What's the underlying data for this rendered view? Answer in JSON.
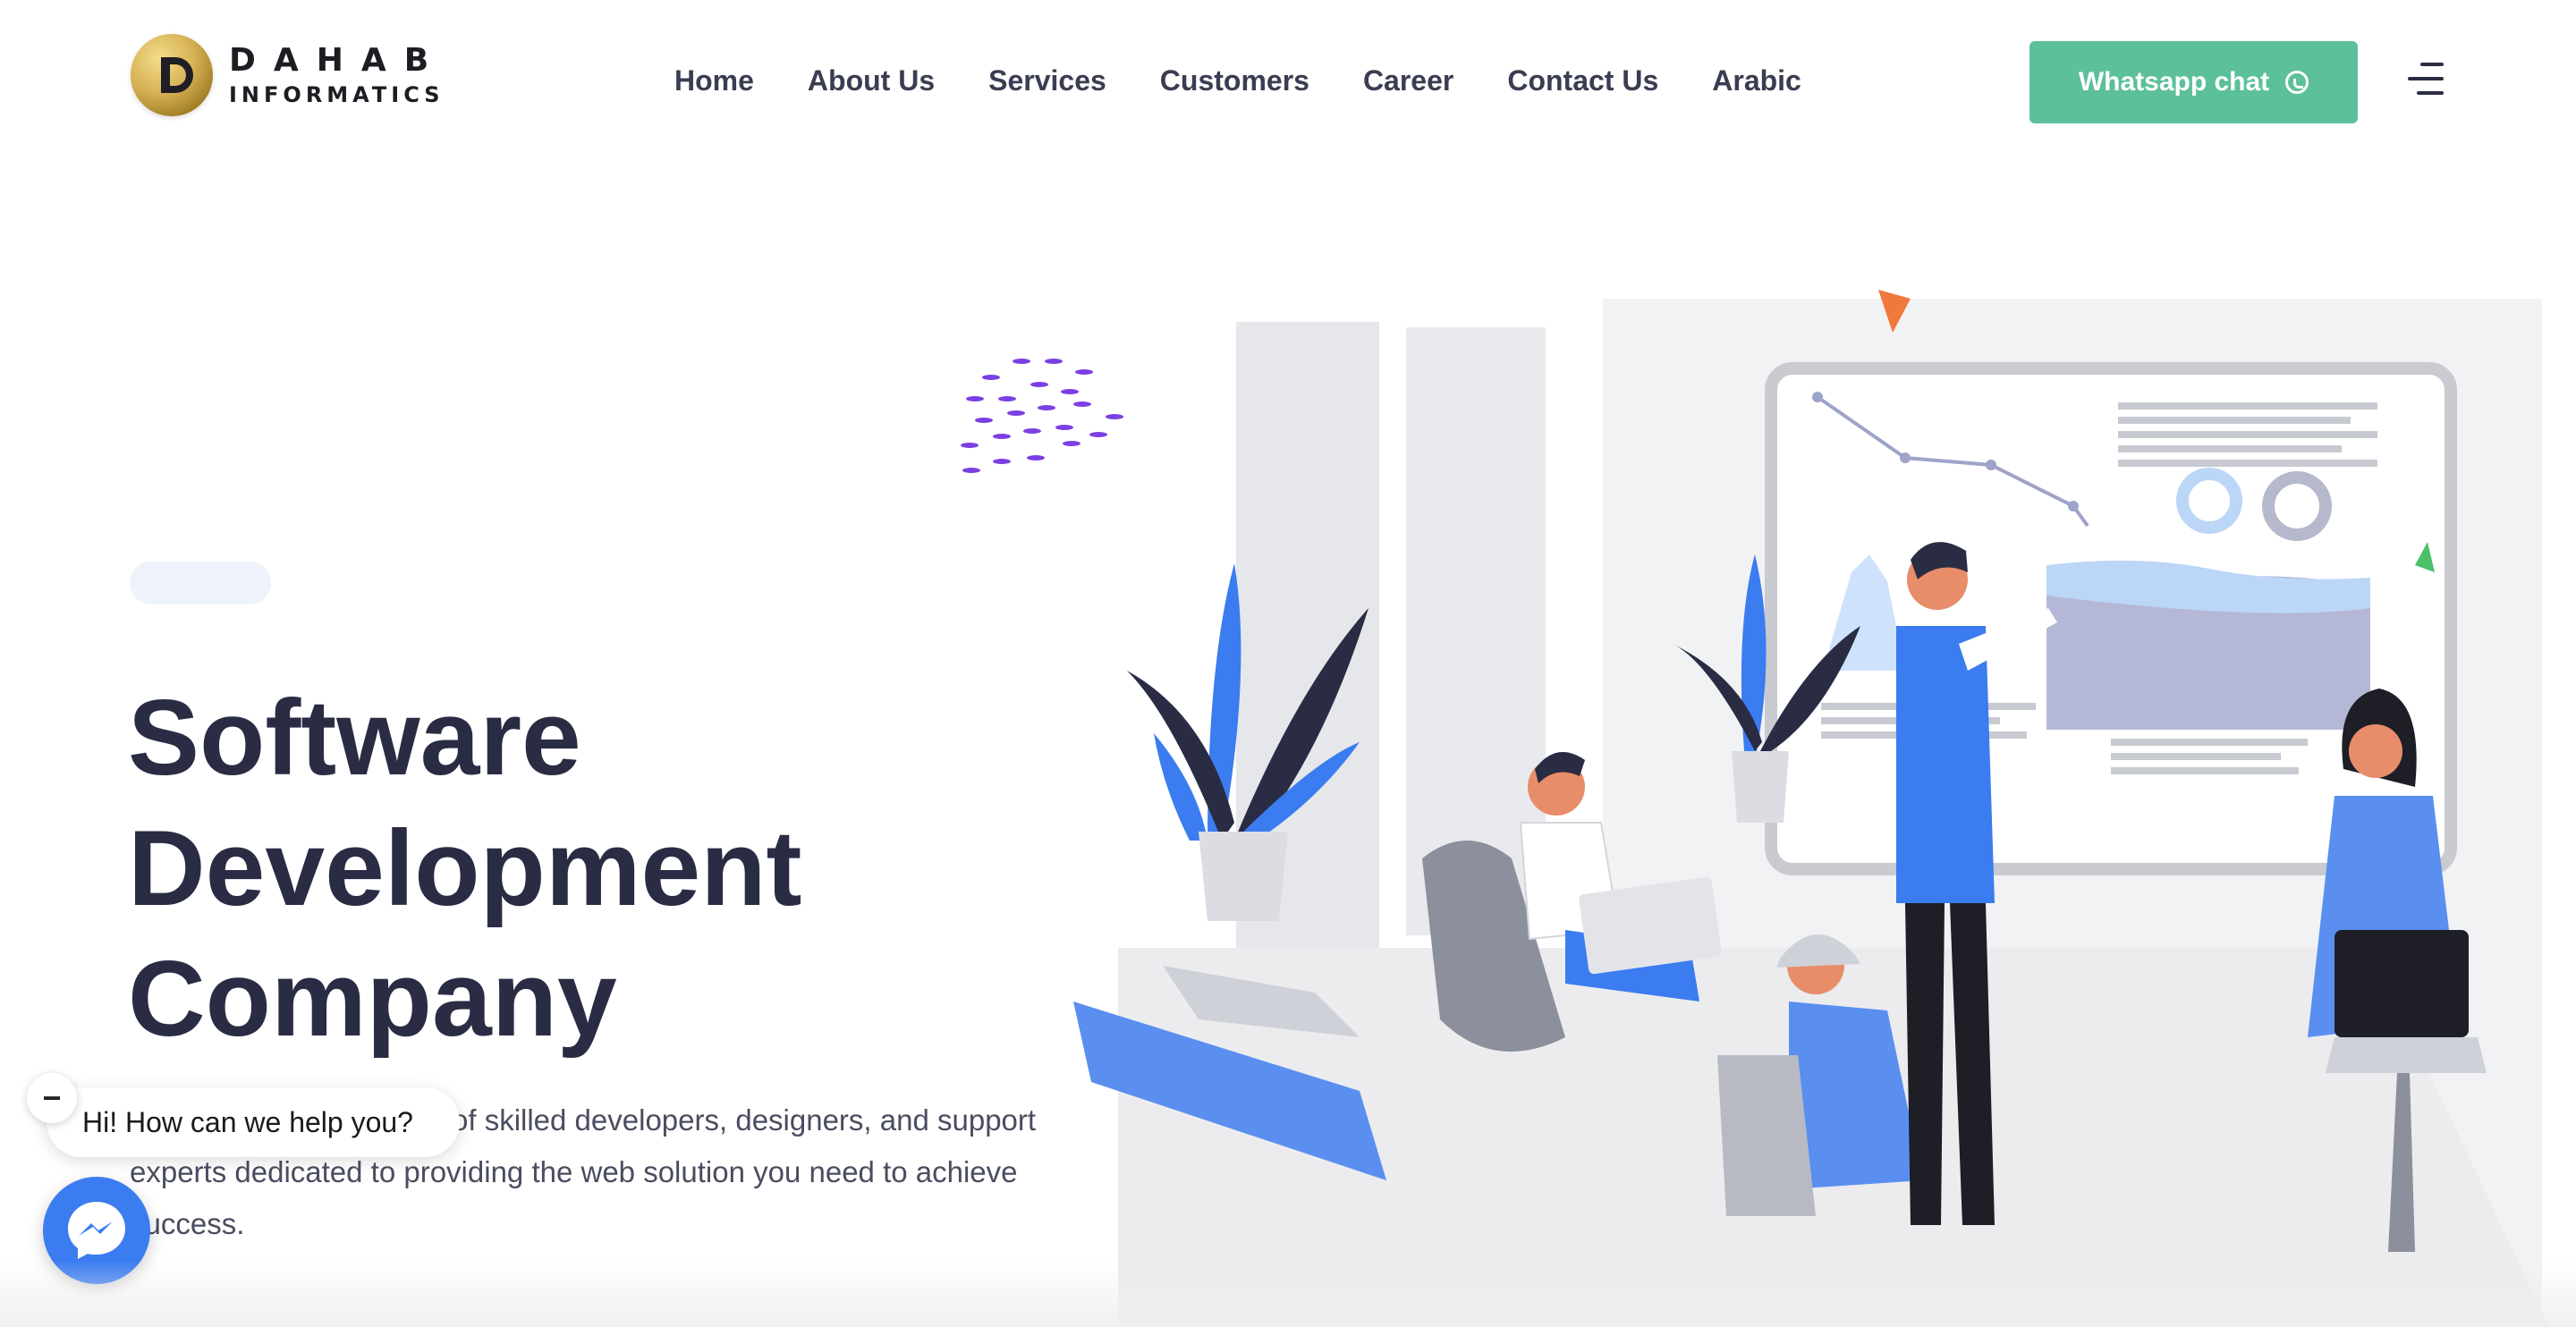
{
  "header": {
    "logo": {
      "line1": "DAHAB",
      "line2": "INFORMATICS"
    },
    "nav": [
      {
        "label": "Home"
      },
      {
        "label": "About Us"
      },
      {
        "label": "Services"
      },
      {
        "label": "Customers"
      },
      {
        "label": "Career"
      },
      {
        "label": "Contact Us"
      },
      {
        "label": "Arabic"
      }
    ],
    "whatsapp_label": "Whatsapp chat",
    "whatsapp_icon": "whatsapp-icon",
    "menu_icon": "hamburger-menu-icon"
  },
  "hero": {
    "title_lines": [
      "Software",
      "Development",
      "Company"
    ],
    "description_visible": "of skilled developers, designers, and support experts dedicated to providing the web solution you need to achieve success."
  },
  "chat": {
    "greeting": "Hi! How can we help you?",
    "close_symbol": "−",
    "messenger_icon": "messenger-icon"
  },
  "colors": {
    "accent_green": "#5cc09a",
    "title_color": "#2a2c44",
    "illustration_blue": "#3b7cf0",
    "messenger_blue": "#3b7cf0"
  }
}
